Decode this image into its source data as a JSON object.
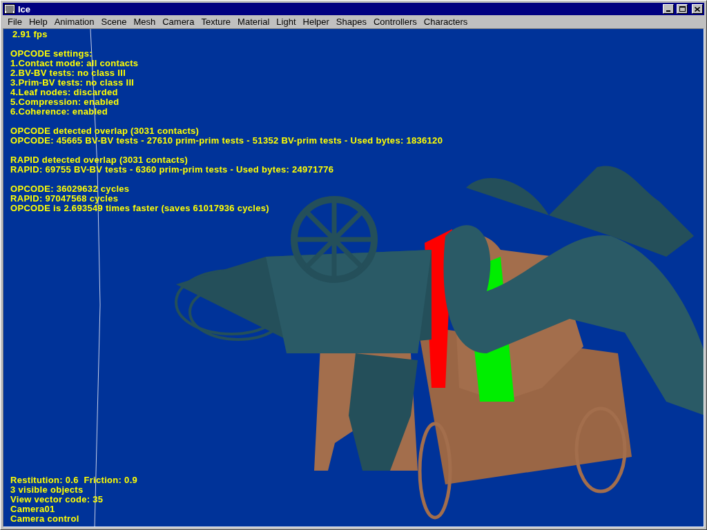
{
  "window": {
    "title": "Ice"
  },
  "menu": [
    "File",
    "Help",
    "Animation",
    "Scene",
    "Mesh",
    "Camera",
    "Texture",
    "Material",
    "Light",
    "Helper",
    "Shapes",
    "Controllers",
    "Characters"
  ],
  "hud": {
    "fps": "2.91 fps",
    "groups": [
      [
        "OPCODE settings:",
        "1.Contact mode: all contacts",
        "2.BV-BV tests: no class III",
        "3.Prim-BV tests: no class III",
        "4.Leaf nodes: discarded",
        "5.Compression: enabled",
        "6.Coherence: enabled"
      ],
      [
        "OPCODE detected overlap (3031 contacts)",
        "OPCODE: 45665 BV-BV tests - 27610 prim-prim tests - 51352 BV-prim tests - Used bytes: 1836120"
      ],
      [
        "RAPID detected overlap (3031 contacts)",
        "RAPID: 69755 BV-BV tests - 6360 prim-prim tests - Used bytes: 24971776"
      ],
      [
        "OPCODE: 36029632 cycles",
        "RAPID: 97047568 cycles",
        "OPCODE is 2.693549 times faster (saves 61017936 cycles)"
      ]
    ],
    "bottom": [
      "Restitution: 0.6  Friction: 0.9",
      "3 visible objects",
      "View vector code: 35",
      "Camera01",
      "Camera control"
    ]
  }
}
